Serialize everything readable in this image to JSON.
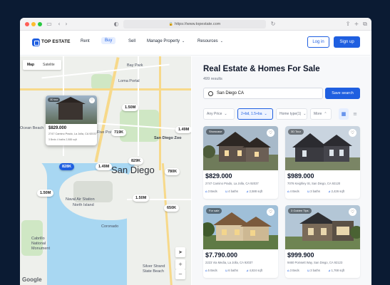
{
  "browser": {
    "url": "https://www.topestate.com",
    "traffic_colors": [
      "#ff5f57",
      "#febc2e",
      "#28c840"
    ]
  },
  "nav": {
    "logo": "TOP ESTATE",
    "links": [
      "Rent",
      "Buy",
      "Sell",
      "Manage Property",
      "Resources"
    ],
    "active": "Buy",
    "login": "Log in",
    "signup": "Sign up"
  },
  "map": {
    "tabs": [
      "Map",
      "Satelite"
    ],
    "active_tab": "Map",
    "places": {
      "city": "San Diego",
      "five_points": "Five Points",
      "ocean_beach": "Ocean Beach",
      "naval_1": "Naval Air Station",
      "naval_2": "North Island",
      "coronado": "Coronado",
      "cabrillo_1": "Cabrillo",
      "cabrillo_2": "National",
      "cabrillo_3": "Monument",
      "silver_1": "Silver Strand",
      "silver_2": "State Beach",
      "balboa": "San Diego Zoo",
      "bay_park": "Bay Park",
      "point_loma": "Loma Portal"
    },
    "price_pins": [
      "1.50M",
      "719K",
      "1.49M",
      "829K",
      "1.49M",
      "780K",
      "828K",
      "1.50M",
      "1.50M",
      "650K"
    ],
    "selected_pin": "828K",
    "popup": {
      "badge": "3D tour",
      "price": "$829.000",
      "address": "2747 Camino Prado, La Jolla, CA 92037",
      "meta": "3 Beds  4 baths  2,588 sqft"
    },
    "attribution": "Google"
  },
  "listings": {
    "title": "Real Estate & Homes For Sale",
    "count": "499 results",
    "search_value": "San Diego CA",
    "search_button": "Save search",
    "filters": [
      "Any Price",
      "2+bd, 1.5+ba",
      "Home type(1)",
      "More"
    ],
    "active_filter": "2+bd, 1.5+ba",
    "cards": [
      {
        "badge": "Showcase",
        "price": "$829.000",
        "address": "2747 Camino Prado, La Jolla, CA 92037",
        "beds": "3 Beds",
        "baths": "4 baths",
        "sqft": "2,588 sqft"
      },
      {
        "badge": "3D Tour",
        "price": "$989.000",
        "address": "7076 Keighley St, San Diego, CA 92120",
        "beds": "4 Beds",
        "baths": "3 baths",
        "sqft": "2,426 sqft"
      },
      {
        "badge": "For sale",
        "price": "$7.790.000",
        "address": "2223 Via Media, La Jolla, CA 92037",
        "beds": "5 Beds",
        "baths": "6 baths",
        "sqft": "4,824 sqft"
      },
      {
        "badge": "3 Golden Tips",
        "price": "$999.900",
        "address": "9460 Poinsett Way, San Diego, CA 92123",
        "beds": "3 Beds",
        "baths": "3 baths",
        "sqft": "1,768 sqft"
      }
    ]
  },
  "colors": {
    "accent": "#1f5fe0",
    "page_bg": "#0b1b33",
    "map_water": "#a8d7f2"
  }
}
